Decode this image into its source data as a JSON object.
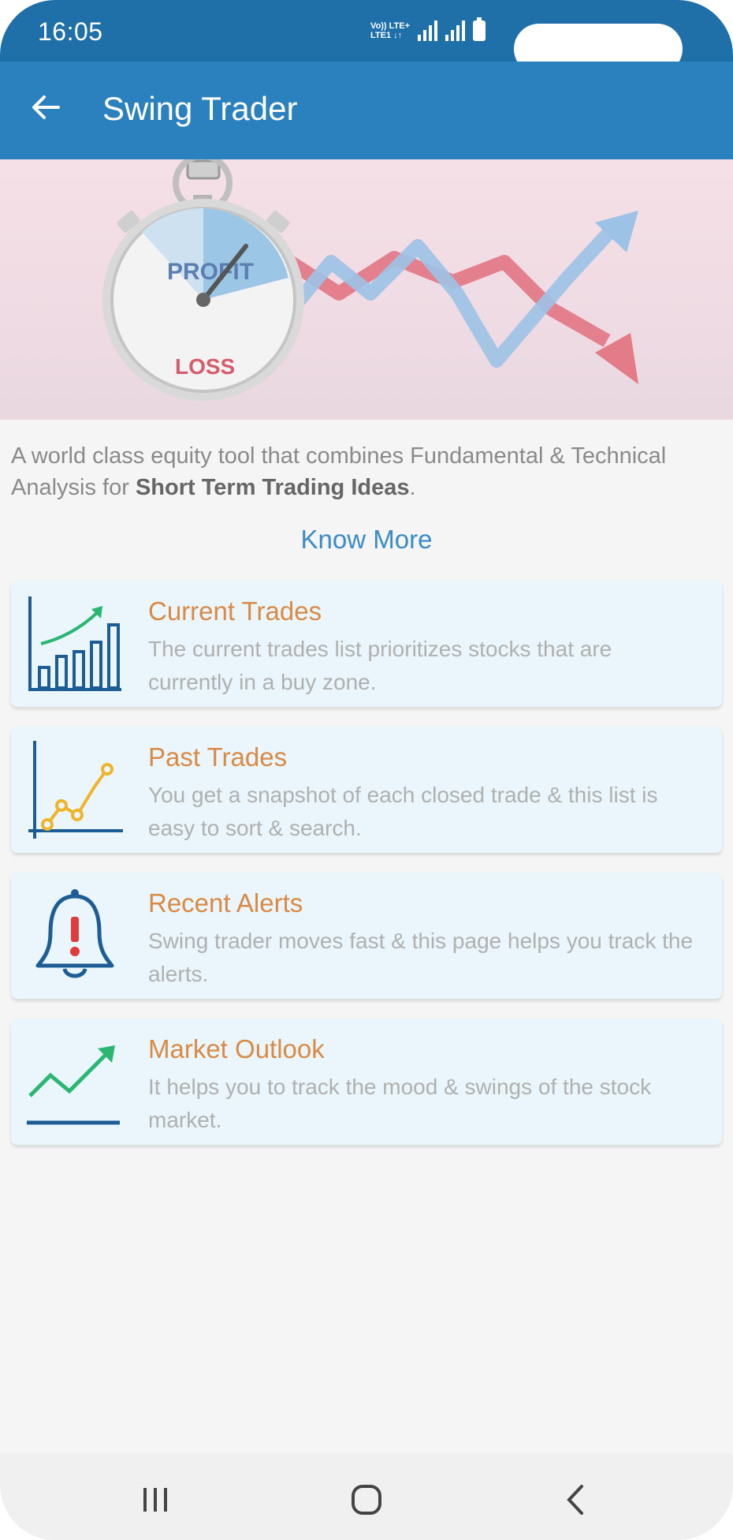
{
  "status_bar": {
    "time": "16:05",
    "network_line1": "Vo)) LTE+",
    "network_line2": "LTE1 ↓↑"
  },
  "app_bar": {
    "title": "Swing Trader"
  },
  "banner": {
    "profit_label": "PROFIT",
    "loss_label": "LOSS"
  },
  "intro": {
    "text_before": "A world class equity tool that combines Fundamental & Technical Analysis for ",
    "text_bold": "Short Term Trading Ideas",
    "text_after": ".",
    "know_more": "Know More"
  },
  "cards": [
    {
      "title": "Current Trades",
      "description": "The current trades list prioritizes stocks that are currently in a buy zone.",
      "icon": "bar-chart-up-icon"
    },
    {
      "title": "Past Trades",
      "description": "You get a snapshot of each closed trade & this list is easy to sort & search.",
      "icon": "line-chart-icon"
    },
    {
      "title": "Recent Alerts",
      "description": "Swing trader moves fast & this page helps you track the alerts.",
      "icon": "bell-alert-icon"
    },
    {
      "title": "Market Outlook",
      "description": "It helps you to track the mood & swings of the stock market.",
      "icon": "trend-up-icon"
    }
  ],
  "colors": {
    "status_bar": "#1f6fa8",
    "app_bar": "#2b80be",
    "card_title": "#d98a45",
    "card_bg": "#eaf6fb",
    "link": "#3b8bc4"
  }
}
